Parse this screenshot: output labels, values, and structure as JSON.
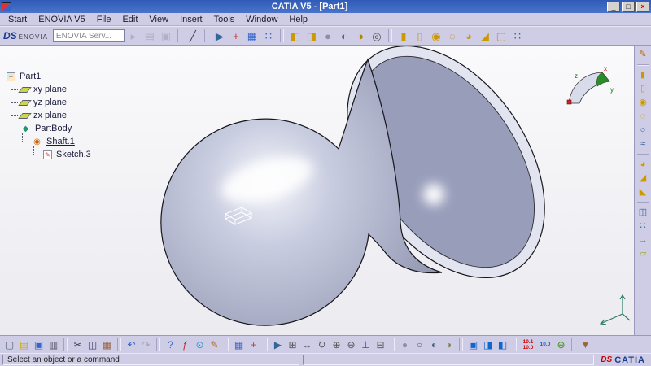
{
  "colors": {
    "titlebar": "#2f5bb7",
    "panel": "#cfcce5",
    "viewport_top": "#fafafc",
    "viewport_bottom": "#ebebf0",
    "solid_base": "#b4b8ce",
    "solid_outline": "#15151c"
  },
  "window": {
    "title": "CATIA V5 - [Part1]",
    "controls": [
      {
        "name": "minimize-button",
        "glyph": "_",
        "cls": "winbtn"
      },
      {
        "name": "maximize-button",
        "glyph": "□",
        "cls": "winbtn"
      },
      {
        "name": "close-button",
        "glyph": "×",
        "cls": "winbtn close"
      }
    ]
  },
  "menubar": {
    "items": [
      {
        "name": "menu-start",
        "label": "Start",
        "cls": "menu-item"
      },
      {
        "name": "menu-enovia-v5",
        "label": "ENOVIA V5",
        "cls": "menu-item"
      },
      {
        "name": "menu-file",
        "label": "File",
        "cls": "menu-item"
      },
      {
        "name": "menu-edit",
        "label": "Edit",
        "cls": "menu-item"
      },
      {
        "name": "menu-view",
        "label": "View",
        "cls": "menu-item"
      },
      {
        "name": "menu-insert",
        "label": "Insert",
        "cls": "menu-item"
      },
      {
        "name": "menu-tools",
        "label": "Tools",
        "cls": "menu-item"
      },
      {
        "name": "menu-window",
        "label": "Window",
        "cls": "menu-item"
      },
      {
        "name": "menu-help",
        "label": "Help",
        "cls": "menu-item"
      }
    ]
  },
  "toolbar_top": {
    "brand": {
      "mark": "DS",
      "label": "ENOVIA"
    },
    "search_value": "ENOVIA Serv...",
    "icons": [
      {
        "name": "enovia-search-go-icon",
        "glyph": "▸",
        "color": "#8890a0",
        "disabled": true
      },
      {
        "name": "enovia-options-icon",
        "glyph": "▤",
        "color": "#8890a0",
        "disabled": true
      },
      {
        "name": "enovia-link-icon",
        "glyph": "▣",
        "color": "#8890a0",
        "disabled": true
      },
      {
        "sep": true
      },
      {
        "name": "knife-tool-icon",
        "glyph": "╱",
        "color": "#445"
      },
      {
        "sep": true
      },
      {
        "name": "fly-mode-icon",
        "glyph": "▶",
        "color": "#369"
      },
      {
        "name": "compass-orient-icon",
        "glyph": "+",
        "color": "#c33"
      },
      {
        "name": "grid-icon",
        "glyph": "▦",
        "color": "#36c"
      },
      {
        "name": "snap-to-point-icon",
        "glyph": "∷",
        "color": "#36c"
      },
      {
        "sep": true
      },
      {
        "name": "view-orientation-icon",
        "glyph": "◧",
        "color": "#c90"
      },
      {
        "name": "named-views-icon",
        "glyph": "◨",
        "color": "#c90"
      },
      {
        "name": "render-style-icon",
        "glyph": "●",
        "color": "#8a90ac"
      },
      {
        "name": "depth-effect-icon",
        "glyph": "◐",
        "color": "#558"
      },
      {
        "name": "lighting-icon",
        "glyph": "◑",
        "color": "#a80"
      },
      {
        "name": "magnifier-icon",
        "glyph": "◎",
        "color": "#555"
      },
      {
        "sep": true
      },
      {
        "name": "pad-icon",
        "glyph": "▮",
        "color": "#c90"
      },
      {
        "name": "pocket-icon",
        "glyph": "▯",
        "color": "#c90"
      },
      {
        "name": "shaft-icon",
        "glyph": "◉",
        "color": "#c90"
      },
      {
        "name": "groove-icon",
        "glyph": "◌",
        "color": "#b80"
      },
      {
        "name": "fillet-icon",
        "glyph": "◕",
        "color": "#c90"
      },
      {
        "name": "chamfer-icon",
        "glyph": "◢",
        "color": "#c90"
      },
      {
        "name": "shell-icon",
        "glyph": "▢",
        "color": "#c90"
      },
      {
        "name": "pattern-icon",
        "glyph": "∷",
        "color": "#369"
      }
    ]
  },
  "tree": {
    "items": [
      {
        "name": "tree-item-part1",
        "label": "Part1",
        "icon": "part-icon",
        "level": 0
      },
      {
        "name": "tree-item-xy-plane",
        "label": "xy plane",
        "icon": "plane-icon",
        "level": 1
      },
      {
        "name": "tree-item-yz-plane",
        "label": "yz plane",
        "icon": "plane-icon",
        "level": 1
      },
      {
        "name": "tree-item-zx-plane",
        "label": "zx plane",
        "icon": "plane-icon",
        "level": 1
      },
      {
        "name": "tree-item-partbody",
        "label": "PartBody",
        "icon": "partbody-icon",
        "level": 1
      },
      {
        "name": "tree-item-shaft-1",
        "label": "Shaft.1",
        "icon": "shaft-icon",
        "level": 2,
        "underline": true
      },
      {
        "name": "tree-item-sketch-3",
        "label": "Sketch.3",
        "icon": "sketch-icon",
        "level": 3
      }
    ]
  },
  "viewport": {
    "compass": {
      "axes": [
        "x",
        "y",
        "z"
      ]
    }
  },
  "right_toolbar": {
    "icons": [
      {
        "name": "sketch-tool-icon",
        "glyph": "✎",
        "color": "#b60"
      },
      {
        "sep": true
      },
      {
        "name": "pad-tool-icon",
        "glyph": "▮",
        "color": "#c90"
      },
      {
        "name": "pocket-tool-icon",
        "glyph": "▯",
        "color": "#c90"
      },
      {
        "name": "shaft-tool-icon",
        "glyph": "◉",
        "color": "#c90"
      },
      {
        "name": "groove-tool-icon",
        "glyph": "◌",
        "color": "#c90"
      },
      {
        "name": "hole-tool-icon",
        "glyph": "○",
        "color": "#369"
      },
      {
        "name": "rib-tool-icon",
        "glyph": "≈",
        "color": "#369"
      },
      {
        "sep": true
      },
      {
        "name": "fillet-tool-icon",
        "glyph": "◕",
        "color": "#c90"
      },
      {
        "name": "chamfer-tool-icon",
        "glyph": "◢",
        "color": "#c90"
      },
      {
        "name": "draft-tool-icon",
        "glyph": "◣",
        "color": "#c90"
      },
      {
        "sep": true
      },
      {
        "name": "mirror-tool-icon",
        "glyph": "◫",
        "color": "#369"
      },
      {
        "name": "pattern-tool-icon",
        "glyph": "∷",
        "color": "#369"
      },
      {
        "name": "translate-tool-icon",
        "glyph": "→",
        "color": "#2a2"
      },
      {
        "name": "plane-tool-icon",
        "glyph": "▱",
        "color": "#9a2"
      }
    ]
  },
  "toolbar_bottom": {
    "icons": [
      {
        "name": "new-document-icon",
        "glyph": "▢",
        "color": "#567"
      },
      {
        "name": "open-document-icon",
        "glyph": "▤",
        "color": "#ca0"
      },
      {
        "name": "save-icon",
        "glyph": "▣",
        "color": "#36c"
      },
      {
        "name": "quick-print-icon",
        "glyph": "▥",
        "color": "#556"
      },
      {
        "sep": true
      },
      {
        "name": "cut-icon",
        "glyph": "✂",
        "color": "#445"
      },
      {
        "name": "copy-icon",
        "glyph": "◫",
        "color": "#447"
      },
      {
        "name": "paste-icon",
        "glyph": "▦",
        "color": "#964"
      },
      {
        "sep": true
      },
      {
        "name": "undo-icon",
        "glyph": "↶",
        "color": "#36c"
      },
      {
        "name": "redo-icon",
        "glyph": "↷",
        "color": "#9ab"
      },
      {
        "sep": true
      },
      {
        "name": "whats-this-icon",
        "glyph": "?",
        "color": "#36c"
      },
      {
        "name": "formula-icon",
        "glyph": "ƒ",
        "color": "#b33"
      },
      {
        "name": "instant-message-icon",
        "glyph": "⊙",
        "color": "#39c"
      },
      {
        "name": "annotate-icon",
        "glyph": "✎",
        "color": "#b60"
      },
      {
        "sep": true
      },
      {
        "name": "grid-toggle-icon",
        "glyph": "▦",
        "color": "#36c"
      },
      {
        "name": "compass-toggle-icon",
        "glyph": "+",
        "color": "#c33"
      },
      {
        "sep": true
      },
      {
        "name": "fly-icon",
        "glyph": "▶",
        "color": "#369"
      },
      {
        "name": "fit-all-in-icon",
        "glyph": "⊞",
        "color": "#555"
      },
      {
        "name": "pan-icon",
        "glyph": "↔",
        "color": "#555"
      },
      {
        "name": "rotate-icon",
        "glyph": "↻",
        "color": "#555"
      },
      {
        "name": "zoom-in-icon",
        "glyph": "⊕",
        "color": "#555"
      },
      {
        "name": "zoom-out-icon",
        "glyph": "⊖",
        "color": "#555"
      },
      {
        "name": "normal-view-icon",
        "glyph": "⊥",
        "color": "#555"
      },
      {
        "name": "create-multi-view-icon",
        "glyph": "⊟",
        "color": "#555"
      },
      {
        "sep": true
      },
      {
        "name": "shading-icon",
        "glyph": "●",
        "color": "#8a90ac"
      },
      {
        "name": "wireframe-icon",
        "glyph": "○",
        "color": "#556"
      },
      {
        "name": "hide-show-icon",
        "glyph": "◐",
        "color": "#468"
      },
      {
        "name": "swap-visible-space-icon",
        "glyph": "◑",
        "color": "#875"
      },
      {
        "sep": true
      },
      {
        "name": "window-layout-icon",
        "glyph": "▣",
        "color": "#16c"
      },
      {
        "name": "tile-horizontally-icon",
        "glyph": "◨",
        "color": "#16c"
      },
      {
        "name": "tile-vertically-icon",
        "glyph": "◧",
        "color": "#16c"
      },
      {
        "sep": true
      },
      {
        "name": "measure-between-icon",
        "text": "10.1\n10.0",
        "color": "#c00"
      },
      {
        "name": "measure-item-icon",
        "text": "10.0",
        "color": "#06c"
      },
      {
        "name": "measure-inertia-icon",
        "glyph": "⊕",
        "color": "#390"
      },
      {
        "sep": true
      },
      {
        "name": "catalog-browser-icon",
        "glyph": "▼",
        "color": "#963"
      }
    ]
  },
  "statusbar": {
    "message": "Select an object or a command",
    "brand_mark": "DS",
    "brand": "CATIA"
  }
}
